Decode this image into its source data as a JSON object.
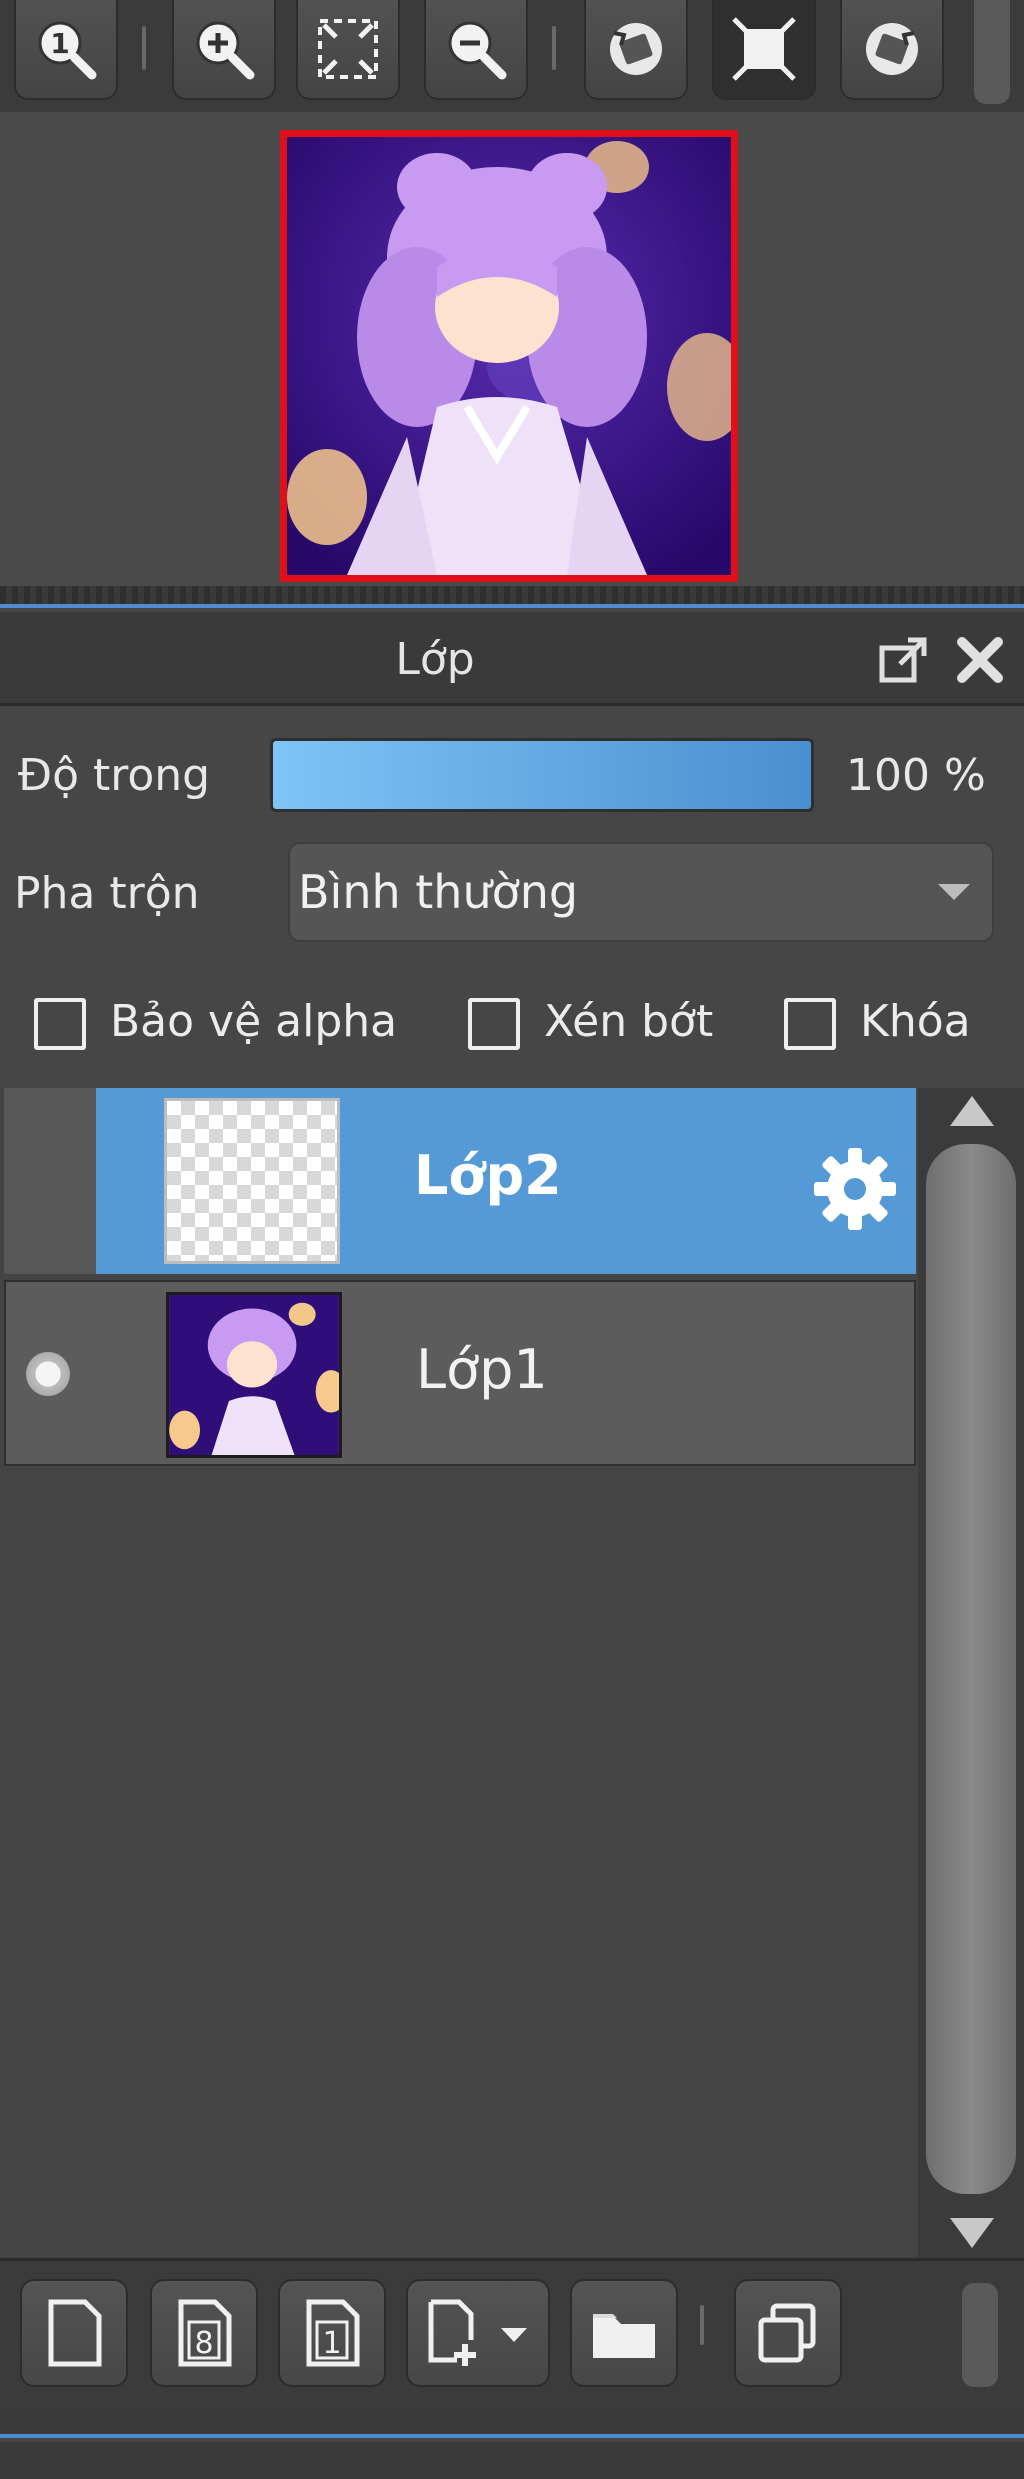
{
  "toolbar": {
    "buttons": [
      {
        "name": "zoom-actual-size",
        "icon": "zoom-1-icon"
      },
      {
        "name": "zoom-in",
        "icon": "zoom-in-icon"
      },
      {
        "name": "fit-to-window",
        "icon": "fit-window-icon"
      },
      {
        "name": "zoom-out",
        "icon": "zoom-out-icon"
      },
      {
        "name": "rotate-left",
        "icon": "rotate-left-icon"
      },
      {
        "name": "reset-rotation",
        "icon": "reset-view-icon"
      },
      {
        "name": "rotate-right",
        "icon": "rotate-right-icon"
      }
    ]
  },
  "layers_panel": {
    "title": "Lớp",
    "opacity_label": "Độ trong",
    "opacity_value": "100 %",
    "opacity_level": 1.0,
    "blend_label": "Pha trộn",
    "blend_value": "Bình thường",
    "checkboxes": {
      "alpha_protect": {
        "label": "Bảo vệ alpha",
        "checked": false
      },
      "clipping": {
        "label": "Xén bớt",
        "checked": false
      },
      "lock": {
        "label": "Khóa",
        "checked": false
      }
    },
    "layers": [
      {
        "name": "Lớp2",
        "selected": true,
        "visible": false
      },
      {
        "name": "Lớp1",
        "selected": false,
        "visible": true
      }
    ]
  },
  "bottom_toolbar": {
    "buttons": [
      {
        "name": "new-layer",
        "icon": "new-page-icon"
      },
      {
        "name": "new-8bit-layer",
        "icon": "layer-8bit-icon",
        "text": "8"
      },
      {
        "name": "new-1bit-layer",
        "icon": "layer-1bit-icon",
        "text": "1"
      },
      {
        "name": "add-layer-menu",
        "icon": "add-layer-dropdown-icon"
      },
      {
        "name": "new-folder",
        "icon": "folder-icon"
      },
      {
        "name": "duplicate-layer",
        "icon": "duplicate-icon"
      }
    ]
  },
  "colors": {
    "accent": "#4c8fd1",
    "selected_row": "#559ad6",
    "panel_bg": "#464646",
    "nav_frame": "#e0101a"
  }
}
